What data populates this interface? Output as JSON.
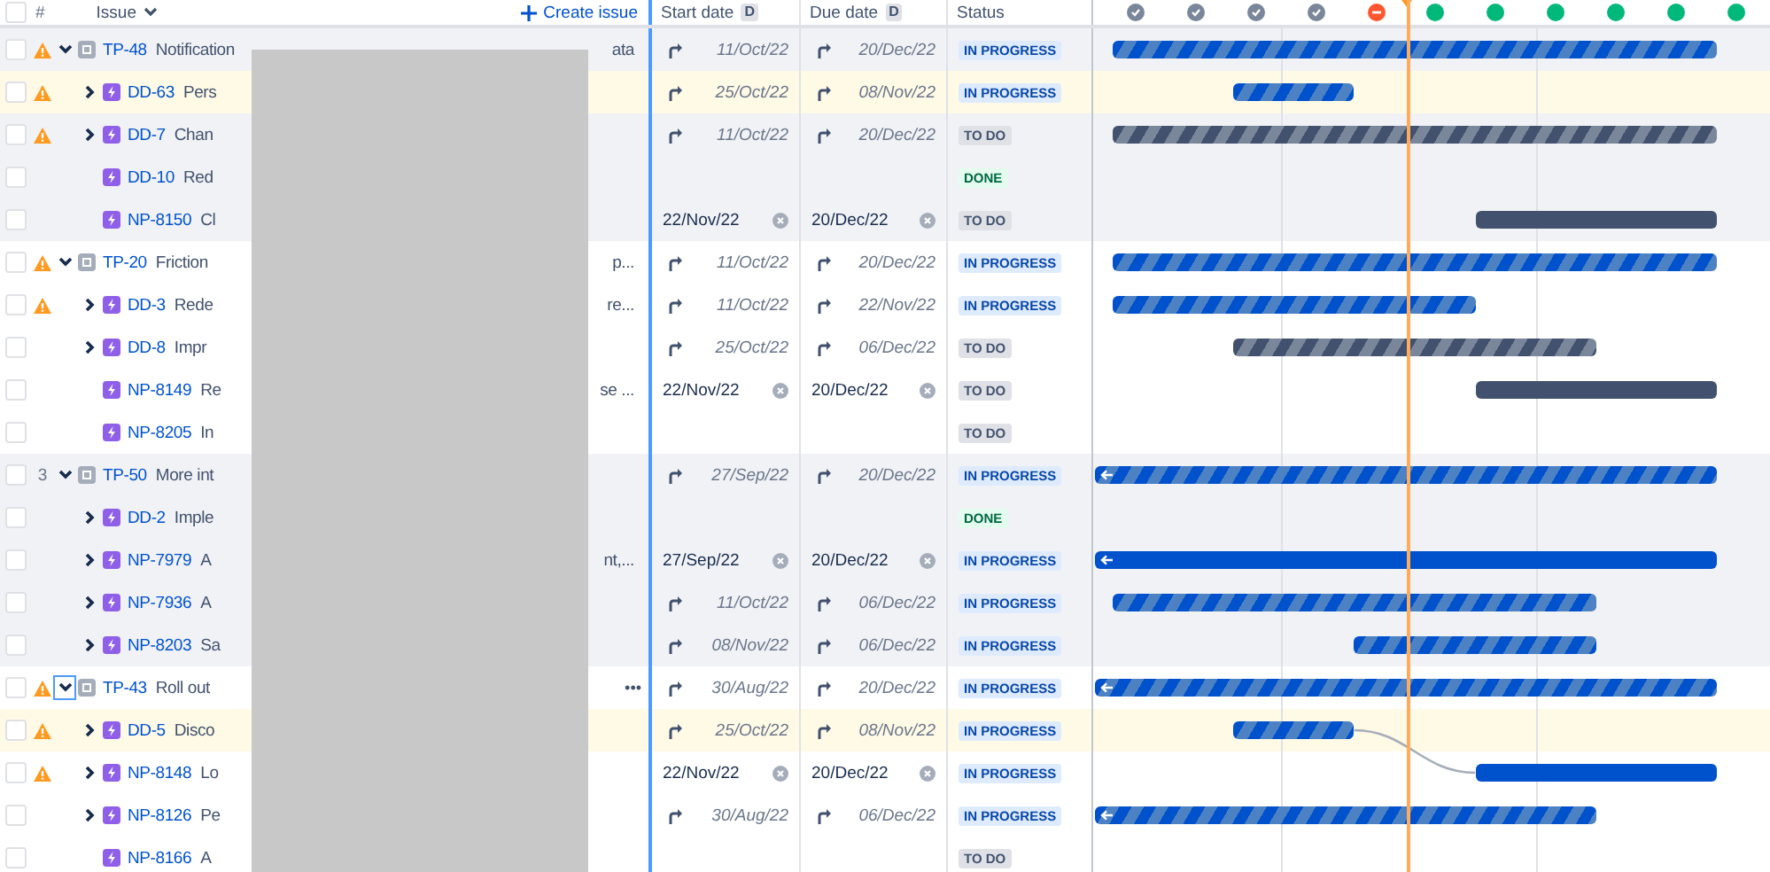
{
  "header": {
    "checked": false,
    "rank_label": "#",
    "issue_label": "Issue",
    "create_label": "Create issue",
    "start_label": "Start date",
    "start_badge": "D",
    "due_label": "Due date",
    "due_badge": "D",
    "status_label": "Status"
  },
  "sprints": [
    {
      "kind": "done"
    },
    {
      "kind": "done"
    },
    {
      "kind": "done"
    },
    {
      "kind": "done"
    },
    {
      "kind": "overdue"
    },
    {
      "kind": "upcoming"
    },
    {
      "kind": "upcoming"
    },
    {
      "kind": "upcoming"
    },
    {
      "kind": "upcoming"
    },
    {
      "kind": "upcoming"
    },
    {
      "kind": "upcoming"
    }
  ],
  "epics": [
    {
      "key": "TP-48",
      "summary": "Notification",
      "summary_tail": "ata",
      "shaded": true,
      "highlighted": false,
      "checked": false,
      "warning": true,
      "expandable": true,
      "expanded": true,
      "focused": false,
      "start": {
        "text": "11/Oct/22",
        "inherited": true
      },
      "due": {
        "text": "20/Dec/22",
        "inherited": true
      },
      "status": {
        "label": "IN PROGRESS",
        "kind": "inprogress"
      },
      "children": [
        {
          "key": "DD-63",
          "summary": "Pers",
          "highlighted": true,
          "checked": false,
          "warning": true,
          "expandable": true,
          "expanded": false,
          "focused": false,
          "start": {
            "text": "25/Oct/22",
            "inherited": true
          },
          "due": {
            "text": "08/Nov/22",
            "inherited": true
          },
          "status": {
            "label": "IN PROGRESS",
            "kind": "inprogress"
          }
        },
        {
          "key": "DD-7",
          "summary": "Chan",
          "highlighted": false,
          "checked": false,
          "warning": true,
          "expandable": true,
          "expanded": false,
          "focused": false,
          "start": {
            "text": "11/Oct/22",
            "inherited": true
          },
          "due": {
            "text": "20/Dec/22",
            "inherited": true
          },
          "status": {
            "label": "TO DO",
            "kind": "todo"
          }
        },
        {
          "key": "DD-10",
          "summary": "Red",
          "highlighted": false,
          "checked": false,
          "warning": false,
          "expandable": false,
          "status": {
            "label": "DONE",
            "kind": "done"
          }
        },
        {
          "key": "NP-8150",
          "summary": "Cl",
          "highlighted": false,
          "checked": false,
          "warning": false,
          "expandable": false,
          "start": {
            "text": "22/Nov/22",
            "inherited": false
          },
          "due": {
            "text": "20/Dec/22",
            "inherited": false
          },
          "status": {
            "label": "TO DO",
            "kind": "todo"
          }
        }
      ]
    },
    {
      "key": "TP-20",
      "summary": "Friction",
      "summary_tail": "p...",
      "shaded": false,
      "highlighted": false,
      "checked": false,
      "warning": true,
      "expandable": true,
      "expanded": true,
      "focused": false,
      "start": {
        "text": "11/Oct/22",
        "inherited": true
      },
      "due": {
        "text": "20/Dec/22",
        "inherited": true
      },
      "status": {
        "label": "IN PROGRESS",
        "kind": "inprogress"
      },
      "children": [
        {
          "key": "DD-3",
          "summary": "Rede",
          "summary_tail": "re...",
          "highlighted": false,
          "checked": false,
          "warning": true,
          "expandable": true,
          "expanded": false,
          "focused": false,
          "start": {
            "text": "11/Oct/22",
            "inherited": true
          },
          "due": {
            "text": "22/Nov/22",
            "inherited": true
          },
          "status": {
            "label": "IN PROGRESS",
            "kind": "inprogress"
          }
        },
        {
          "key": "DD-8",
          "summary": "Impr",
          "highlighted": false,
          "checked": false,
          "warning": false,
          "expandable": true,
          "expanded": false,
          "focused": false,
          "start": {
            "text": "25/Oct/22",
            "inherited": true
          },
          "due": {
            "text": "06/Dec/22",
            "inherited": true
          },
          "status": {
            "label": "TO DO",
            "kind": "todo"
          }
        },
        {
          "key": "NP-8149",
          "summary": "Re",
          "summary_tail": "se ...",
          "highlighted": false,
          "checked": false,
          "warning": false,
          "expandable": false,
          "start": {
            "text": "22/Nov/22",
            "inherited": false
          },
          "due": {
            "text": "20/Dec/22",
            "inherited": false
          },
          "status": {
            "label": "TO DO",
            "kind": "todo"
          }
        },
        {
          "key": "NP-8205",
          "summary": "In",
          "highlighted": false,
          "checked": false,
          "warning": false,
          "expandable": false,
          "status": {
            "label": "TO DO",
            "kind": "todo"
          }
        }
      ]
    },
    {
      "key": "TP-50",
      "rank": "3",
      "summary": "More int",
      "shaded": true,
      "highlighted": false,
      "checked": false,
      "warning": false,
      "expandable": true,
      "expanded": true,
      "focused": false,
      "start": {
        "text": "27/Sep/22",
        "inherited": true
      },
      "due": {
        "text": "20/Dec/22",
        "inherited": true
      },
      "status": {
        "label": "IN PROGRESS",
        "kind": "inprogress"
      },
      "children": [
        {
          "key": "DD-2",
          "summary": "Imple",
          "highlighted": false,
          "checked": false,
          "warning": false,
          "expandable": true,
          "expanded": false,
          "focused": false,
          "status": {
            "label": "DONE",
            "kind": "done"
          }
        },
        {
          "key": "NP-7979",
          "summary": "A",
          "summary_tail": "nt,...",
          "highlighted": false,
          "checked": false,
          "warning": false,
          "expandable": true,
          "expanded": false,
          "focused": false,
          "start": {
            "text": "27/Sep/22",
            "inherited": false
          },
          "due": {
            "text": "20/Dec/22",
            "inherited": false
          },
          "status": {
            "label": "IN PROGRESS",
            "kind": "inprogress"
          }
        },
        {
          "key": "NP-7936",
          "summary": "A",
          "highlighted": false,
          "checked": false,
          "warning": false,
          "expandable": true,
          "expanded": false,
          "focused": false,
          "start": {
            "text": "11/Oct/22",
            "inherited": true
          },
          "due": {
            "text": "06/Dec/22",
            "inherited": true
          },
          "status": {
            "label": "IN PROGRESS",
            "kind": "inprogress"
          }
        },
        {
          "key": "NP-8203",
          "summary": "Sa",
          "highlighted": false,
          "checked": false,
          "warning": false,
          "expandable": true,
          "expanded": false,
          "focused": false,
          "start": {
            "text": "08/Nov/22",
            "inherited": true
          },
          "due": {
            "text": "06/Dec/22",
            "inherited": true
          },
          "status": {
            "label": "IN PROGRESS",
            "kind": "inprogress"
          }
        }
      ]
    },
    {
      "key": "TP-43",
      "summary": "Roll out",
      "actions": "•••",
      "shaded": false,
      "highlighted": false,
      "checked": false,
      "warning": true,
      "expandable": true,
      "expanded": true,
      "focused": true,
      "start": {
        "text": "30/Aug/22",
        "inherited": true
      },
      "due": {
        "text": "20/Dec/22",
        "inherited": true
      },
      "status": {
        "label": "IN PROGRESS",
        "kind": "inprogress"
      },
      "children": [
        {
          "key": "DD-5",
          "summary": "Disco",
          "highlighted": true,
          "checked": false,
          "warning": true,
          "expandable": true,
          "expanded": false,
          "focused": false,
          "links_to_next": true,
          "start": {
            "text": "25/Oct/22",
            "inherited": true
          },
          "due": {
            "text": "08/Nov/22",
            "inherited": true
          },
          "status": {
            "label": "IN PROGRESS",
            "kind": "inprogress"
          }
        },
        {
          "key": "NP-8148",
          "summary": "Lo",
          "highlighted": false,
          "checked": false,
          "warning": true,
          "expandable": true,
          "expanded": false,
          "focused": false,
          "start": {
            "text": "22/Nov/22",
            "inherited": false
          },
          "due": {
            "text": "20/Dec/22",
            "inherited": false
          },
          "status": {
            "label": "IN PROGRESS",
            "kind": "inprogress"
          }
        },
        {
          "key": "NP-8126",
          "summary": "Pe",
          "highlighted": false,
          "checked": false,
          "warning": false,
          "expandable": true,
          "expanded": false,
          "focused": false,
          "start": {
            "text": "30/Aug/22",
            "inherited": true
          },
          "due": {
            "text": "06/Dec/22",
            "inherited": true
          },
          "status": {
            "label": "IN PROGRESS",
            "kind": "inprogress"
          }
        },
        {
          "key": "NP-8166",
          "summary": "A",
          "highlighted": false,
          "checked": false,
          "warning": false,
          "expandable": false,
          "status": {
            "label": "TO DO",
            "kind": "todo"
          }
        }
      ]
    }
  ]
}
